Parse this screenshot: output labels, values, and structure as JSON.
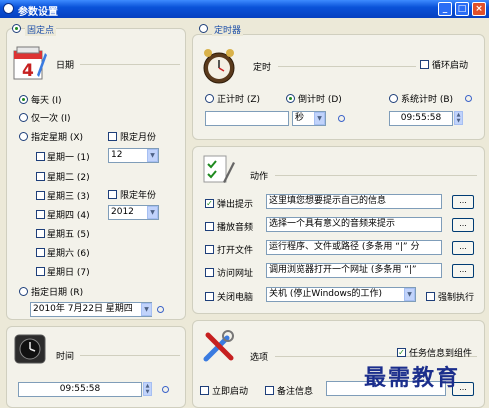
{
  "window": {
    "title": "参数设置",
    "minimize": "_",
    "maximize": "□",
    "close": "×"
  },
  "fixed_point": {
    "label": "固定点",
    "date_label": "日期",
    "daily": "每天 (I)",
    "once": "仅一次 (I)",
    "weekday": "指定星期 (X)",
    "limit_month": "限定月份",
    "month_value": "12",
    "limit_year": "限定年份",
    "year_value": "2012",
    "weekdays": [
      "星期一 (1)",
      "星期二 (2)",
      "星期三 (3)",
      "星期四 (4)",
      "星期五 (5)",
      "星期六 (6)",
      "星期日 (7)"
    ],
    "specific_date": "指定日期 (R)",
    "date_value": "2010年 7月22日 星期四",
    "time_label": "时间",
    "time_value": "09:55:58"
  },
  "timer": {
    "label": "定时器",
    "timing_label": "定时",
    "loop_start": "循环启动",
    "count_up": "正计时 (Z)",
    "count_down": "倒计时 (D)",
    "system_time": "系统计时 (B)",
    "count_value": "",
    "unit": "秒",
    "system_time_value": "09:55:58"
  },
  "action": {
    "label": "动作",
    "items": [
      {
        "label": "弹出提示",
        "value": "这里填您想要提示自己的信息",
        "btn": "..."
      },
      {
        "label": "播放音频",
        "value": "选择一个具有意义的音频来提示",
        "btn": "..."
      },
      {
        "label": "打开文件",
        "value": "运行程序、文件或路径 (多条用 “|” 分",
        "btn": "..."
      },
      {
        "label": "访问网址",
        "value": "调用浏览器打开一个网址 (多条用 “|”",
        "btn": "..."
      }
    ],
    "shutdown_label": "关闭电脑",
    "shutdown_value": "关机 (停止Windows的工作)",
    "force": "强制执行"
  },
  "options": {
    "label": "选项",
    "task_to_tray": "任务信息到组件",
    "start_now": "立即启动",
    "note": "备注信息",
    "btn": "..."
  },
  "watermark": "最需教育"
}
